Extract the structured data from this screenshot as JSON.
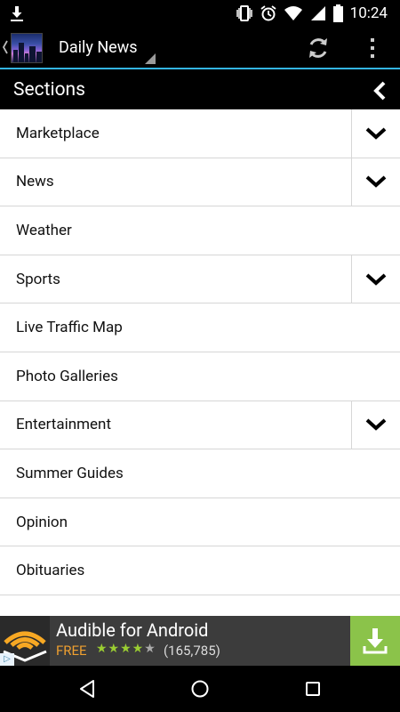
{
  "status_bar": {
    "time": "10:24",
    "icons": [
      "download-icon",
      "vibrate-icon",
      "alarm-icon",
      "wifi-icon",
      "signal-icon",
      "battery-icon"
    ]
  },
  "action_bar": {
    "title": "Daily News",
    "icons": [
      "back-chevron-icon",
      "refresh-icon",
      "overflow-menu-icon"
    ],
    "accent_color": "#33b5e5"
  },
  "sections": {
    "title": "Sections",
    "items": [
      {
        "label": "Marketplace",
        "expandable": true
      },
      {
        "label": "News",
        "expandable": true
      },
      {
        "label": "Weather",
        "expandable": false
      },
      {
        "label": "Sports",
        "expandable": true
      },
      {
        "label": "Live Traffic Map",
        "expandable": false
      },
      {
        "label": "Photo Galleries",
        "expandable": false
      },
      {
        "label": "Entertainment",
        "expandable": true
      },
      {
        "label": "Summer Guides",
        "expandable": false
      },
      {
        "label": "Opinion",
        "expandable": false
      },
      {
        "label": "Obituaries",
        "expandable": false
      },
      {
        "label": "",
        "expandable": false
      }
    ]
  },
  "ad": {
    "title": "Audible for Android",
    "price": "FREE",
    "rating": 4,
    "rating_max": 5,
    "rating_count": "(165,785)",
    "install_color": "#8bc34a"
  }
}
